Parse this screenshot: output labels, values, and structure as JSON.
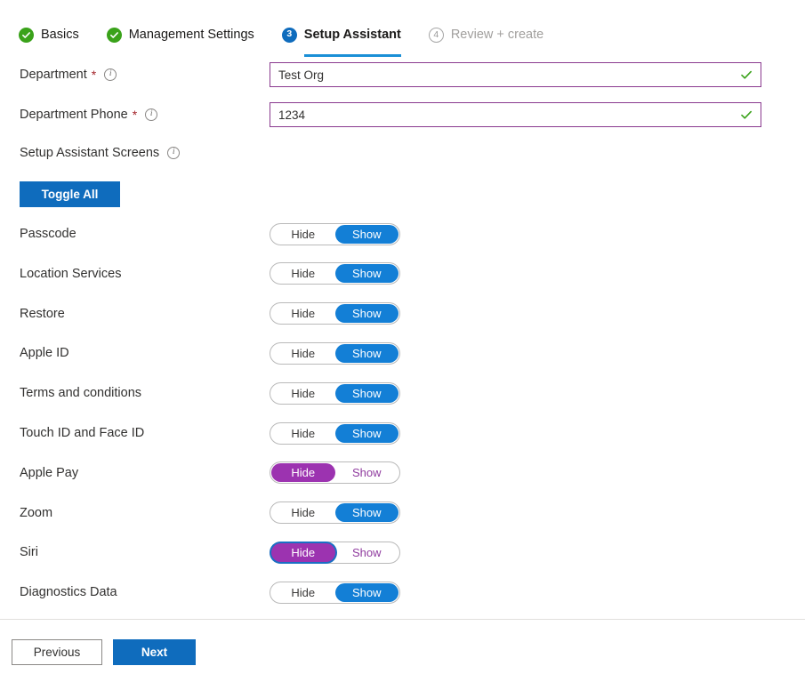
{
  "wizard": {
    "steps": [
      {
        "label": "Basics",
        "state": "done",
        "number": "1",
        "icon": "check-circle-icon"
      },
      {
        "label": "Management Settings",
        "state": "done",
        "number": "2",
        "icon": "check-circle-icon"
      },
      {
        "label": "Setup Assistant",
        "state": "current",
        "number": "3",
        "icon": "step-number-badge"
      },
      {
        "label": "Review + create",
        "state": "pending",
        "number": "4",
        "icon": "step-number-badge"
      }
    ]
  },
  "form": {
    "department": {
      "label": "Department",
      "required_marker": "*",
      "info_glyph": "i",
      "value": "Test Org",
      "placeholder": "",
      "validation": "valid",
      "check_glyph": "✓"
    },
    "department_phone": {
      "label": "Department Phone",
      "required_marker": "*",
      "info_glyph": "i",
      "value": "1234",
      "placeholder": "",
      "validation": "valid",
      "check_glyph": "✓"
    },
    "screens_heading": {
      "label": "Setup Assistant Screens",
      "info_glyph": "i"
    },
    "toggle_all_label": "Toggle All"
  },
  "toggle_options": {
    "hide": "Hide",
    "show": "Show"
  },
  "screens": [
    {
      "label": "Passcode",
      "selected": "show",
      "accent": "blue",
      "focused": false
    },
    {
      "label": "Location Services",
      "selected": "show",
      "accent": "blue",
      "focused": false
    },
    {
      "label": "Restore",
      "selected": "show",
      "accent": "blue",
      "focused": false
    },
    {
      "label": "Apple ID",
      "selected": "show",
      "accent": "blue",
      "focused": false
    },
    {
      "label": "Terms and conditions",
      "selected": "show",
      "accent": "blue",
      "focused": false
    },
    {
      "label": "Touch ID and Face ID",
      "selected": "show",
      "accent": "blue",
      "focused": false
    },
    {
      "label": "Apple Pay",
      "selected": "hide",
      "accent": "purple",
      "focused": false
    },
    {
      "label": "Zoom",
      "selected": "show",
      "accent": "blue",
      "focused": false
    },
    {
      "label": "Siri",
      "selected": "hide",
      "accent": "purple",
      "focused": true
    },
    {
      "label": "Diagnostics Data",
      "selected": "show",
      "accent": "blue",
      "focused": false
    }
  ],
  "footer": {
    "previous_label": "Previous",
    "next_label": "Next"
  },
  "colors": {
    "accent_blue": "#0f6cbd",
    "toggle_blue": "#137fd6",
    "toggle_purple": "#9c33b0",
    "valid_green": "#3aa21a",
    "input_border_purple": "#8a3a8f",
    "required_red": "#a4262c",
    "underline_blue": "#1a8fd6"
  }
}
